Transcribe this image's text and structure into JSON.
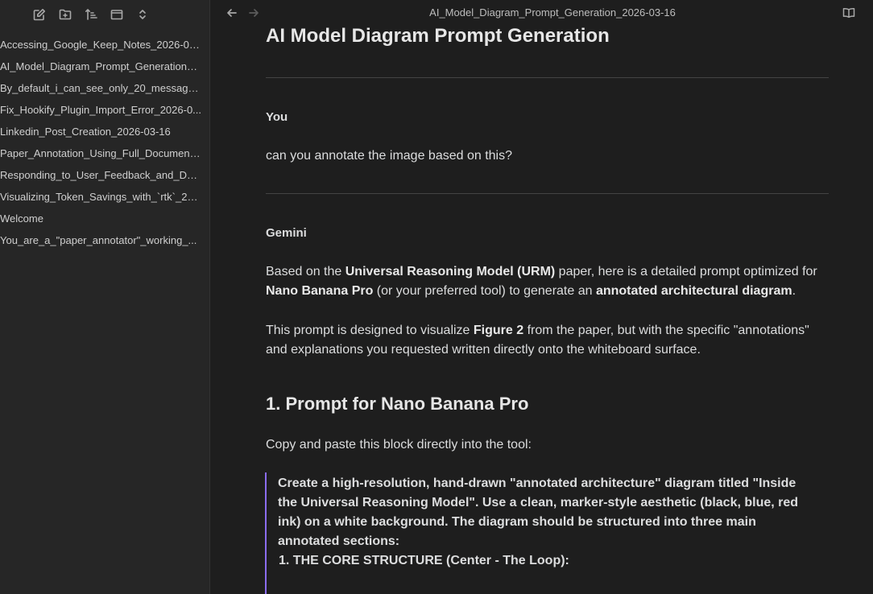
{
  "sidebar": {
    "toolbar": [
      {
        "icon": "new-note-icon"
      },
      {
        "icon": "new-folder-icon"
      },
      {
        "icon": "sort-icon"
      },
      {
        "icon": "collapse-all-icon"
      },
      {
        "icon": "expand-collapse-icon"
      }
    ],
    "files": [
      "Accessing_Google_Keep_Notes_2026-03...",
      "AI_Model_Diagram_Prompt_Generation_...",
      "By_default_i_can_see_only_20_messages...",
      "Fix_Hookify_Plugin_Import_Error_2026-0...",
      "Linkedin_Post_Creation_2026-03-16",
      "Paper_Annotation_Using_Full_Document...",
      "Responding_to_User_Feedback_and_Do...",
      "Visualizing_Token_Savings_with_`rtk`_20...",
      "Welcome",
      "You_are_a_\"paper_annotator\"_working_..."
    ]
  },
  "topbar": {
    "tab_title": "AI_Model_Diagram_Prompt_Generation_2026-03-16",
    "back_icon": "arrow-left-icon",
    "forward_icon": "arrow-right-icon",
    "reading_view_icon": "book-open-icon"
  },
  "doc": {
    "title": "AI Model Diagram Prompt Generation",
    "you_label": "You",
    "question": "can you annotate the image based on this?",
    "gemini_label": "Gemini",
    "para1": {
      "t1": "Based on the ",
      "b1": "Universal Reasoning Model (URM)",
      "t2": " paper, here is a detailed prompt optimized for ",
      "b2": "Nano Banana Pro",
      "t3": " (or your preferred tool) to generate an ",
      "b3": "annotated architectural diagram",
      "t4": "."
    },
    "para2": {
      "t1": "This prompt is designed to visualize ",
      "b1": "Figure 2",
      "t2": " from the paper, but with the specific \"annotations\" and explanations you requested written directly onto the whiteboard surface."
    },
    "section_heading": "1. Prompt for Nano Banana Pro",
    "copy_line": "Copy and paste this block directly into the tool:",
    "quote_text": "Create a high-resolution, hand-drawn \"annotated architecture\" diagram titled \"Inside the Universal Reasoning Model\". Use a clean, marker-style aesthetic (black, blue, red ink) on a white background. The diagram should be structured into three main annotated sections:",
    "quote_section": "1. THE CORE STRUCTURE (Center - The Loop):"
  },
  "colors": {
    "background": "#1e1e1e",
    "sidebar": "#262626",
    "accent_quote": "#8b6cef"
  }
}
